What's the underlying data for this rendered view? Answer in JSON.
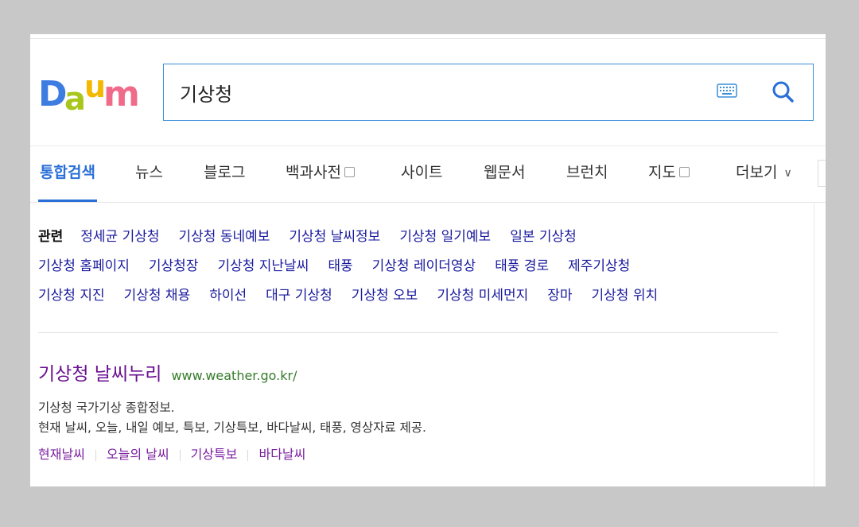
{
  "logo": {
    "text": "Daum",
    "letters": [
      "D",
      "a",
      "u",
      "m"
    ]
  },
  "search": {
    "query": "기상청"
  },
  "icons": {
    "keyboard": "keyboard-icon",
    "search": "search-icon"
  },
  "tabs": [
    {
      "label": "통합검색",
      "active": true
    },
    {
      "label": "뉴스"
    },
    {
      "label": "블로그"
    },
    {
      "label": "백과사전",
      "checkbox": true
    },
    {
      "label": "사이트"
    },
    {
      "label": "웹문서"
    },
    {
      "label": "브런치"
    },
    {
      "label": "지도",
      "checkbox": true
    },
    {
      "label": "더보기",
      "chevron": "∨"
    }
  ],
  "related": {
    "label": "관련",
    "lines": [
      [
        "정세균 기상청",
        "기상청 동네예보",
        "기상청 날씨정보",
        "기상청 일기예보",
        "일본 기상청"
      ],
      [
        "기상청 홈페이지",
        "기상청장",
        "기상청 지난날씨",
        "태풍",
        "기상청 레이더영상",
        "태풍 경로",
        "제주기상청"
      ],
      [
        "기상청 지진",
        "기상청 채용",
        "하이선",
        "대구 기상청",
        "기상청 오보",
        "기상청 미세먼지",
        "장마",
        "기상청 위치"
      ]
    ]
  },
  "result": {
    "title": "기상청 날씨누리",
    "url": "www.weather.go.kr/",
    "desc_line1": "기상청 국가기상 종합정보.",
    "desc_line2": "현재 날씨, 오늘, 내일 예보, 특보, 기상특보, 바다날씨, 태풍, 영상자료 제공.",
    "links": [
      "현재날씨",
      "오늘의 날씨",
      "기상특보",
      "바다날씨"
    ]
  },
  "colors": {
    "accent": "#2a6fd8",
    "link": "#1a1a9e",
    "visited": "#6a0f90",
    "url": "#367c2b",
    "logo_d": "#3d7ce0",
    "logo_a": "#f5b800",
    "logo_u": "#e8483e",
    "logo_m": "#f06bb2"
  }
}
